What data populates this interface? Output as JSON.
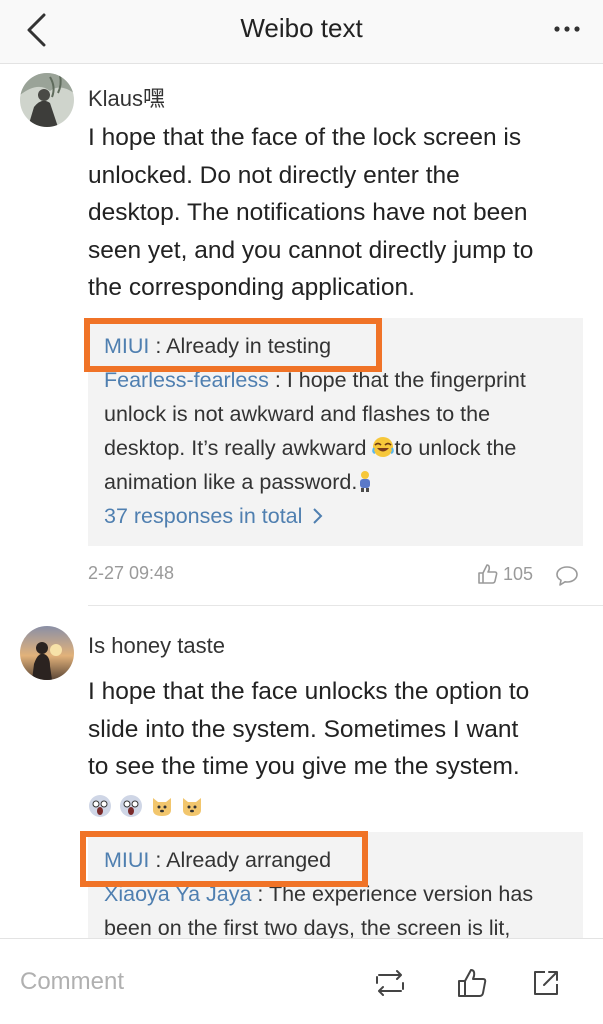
{
  "header": {
    "title": "Weibo text",
    "back_icon": "chevron-left-icon",
    "more_icon": "more-dots-icon"
  },
  "comments": [
    {
      "username": "Klaus嘿",
      "text": "I hope that the face of the lock screen is unlocked. Do not directly enter the desktop. The notifications have not been seen yet, and you cannot directly jump to the corresponding application.",
      "lines": [
        "I hope that the face of the lock screen is",
        "unlocked. Do not directly enter the",
        "desktop. The notifications have not been",
        "seen yet, and you cannot directly jump to",
        "the corresponding application."
      ],
      "replies": [
        {
          "author": "MIUI",
          "sep": " : ",
          "text": "Already in testing"
        },
        {
          "author": "Fearless-fearless",
          "sep": " : ",
          "lines": [
            "I hope that the fingerprint",
            "unlock is not awkward and flashes to the",
            "desktop. It’s really awkward ",
            "to unlock the",
            "animation like a password."
          ]
        }
      ],
      "more_replies": "37 responses in total",
      "timestamp": "2-27 09:48",
      "likes": "105"
    },
    {
      "username": "Is honey taste",
      "lines": [
        "I hope that the face unlocks the option to",
        "slide into the system. Sometimes I want",
        "to see the time you give me the system."
      ],
      "emojis": [
        "😱",
        "😱",
        "🐶",
        "🐶"
      ],
      "replies": [
        {
          "author": "MIUI",
          "sep": " : ",
          "text": "Already arranged"
        },
        {
          "author": "Xiaoya Ya Jaya",
          "sep": " : ",
          "lines": [
            "The experience version has",
            "been on the first two days, the screen is lit,"
          ]
        }
      ]
    }
  ],
  "bottom_bar": {
    "placeholder": "Comment",
    "repost_icon": "repost-icon",
    "like_icon": "thumbs-up-icon",
    "share_icon": "share-icon"
  },
  "colors": {
    "link": "#4f7fb0",
    "highlight": "#f07327",
    "reply_bg": "#f3f3f3"
  }
}
